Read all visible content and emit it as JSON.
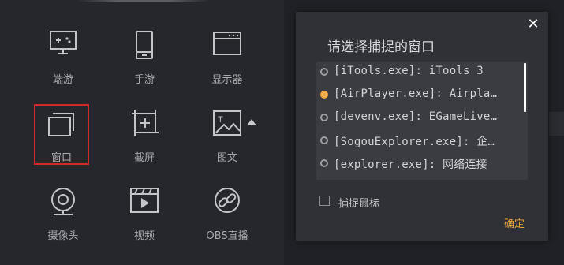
{
  "sources": {
    "items": [
      {
        "label": "端游",
        "icon": "gamepad-monitor-icon"
      },
      {
        "label": "手游",
        "icon": "mobile-phone-icon"
      },
      {
        "label": "显示器",
        "icon": "display-window-icon"
      },
      {
        "label": "窗口",
        "icon": "window-stack-icon"
      },
      {
        "label": "截屏",
        "icon": "crop-screenshot-icon"
      },
      {
        "label": "图文",
        "icon": "image-text-icon"
      },
      {
        "label": "摄像头",
        "icon": "webcam-icon"
      },
      {
        "label": "视频",
        "icon": "video-clapper-icon"
      },
      {
        "label": "OBS直播",
        "icon": "link-chain-icon"
      }
    ],
    "selected": "窗口"
  },
  "dialog": {
    "title": "请选择捕捉的窗口",
    "close_glyph": "✕",
    "windows": [
      {
        "text": "[iTools.exe]: iTools 3",
        "checked": false
      },
      {
        "text": "[AirPlayer.exe]: Airpla…",
        "checked": true
      },
      {
        "text": "[devenv.exe]: EGameLive…",
        "checked": false
      },
      {
        "text": "[SogouExplorer.exe]: 企…",
        "checked": false
      },
      {
        "text": "[explorer.exe]: 网络连接",
        "checked": false
      }
    ],
    "capture_mouse_label": "捕捉鼠标",
    "capture_mouse_checked": false,
    "ok_label": "确定"
  },
  "colors": {
    "accent": "#e8a23c",
    "selection_border": "#d5282a"
  }
}
